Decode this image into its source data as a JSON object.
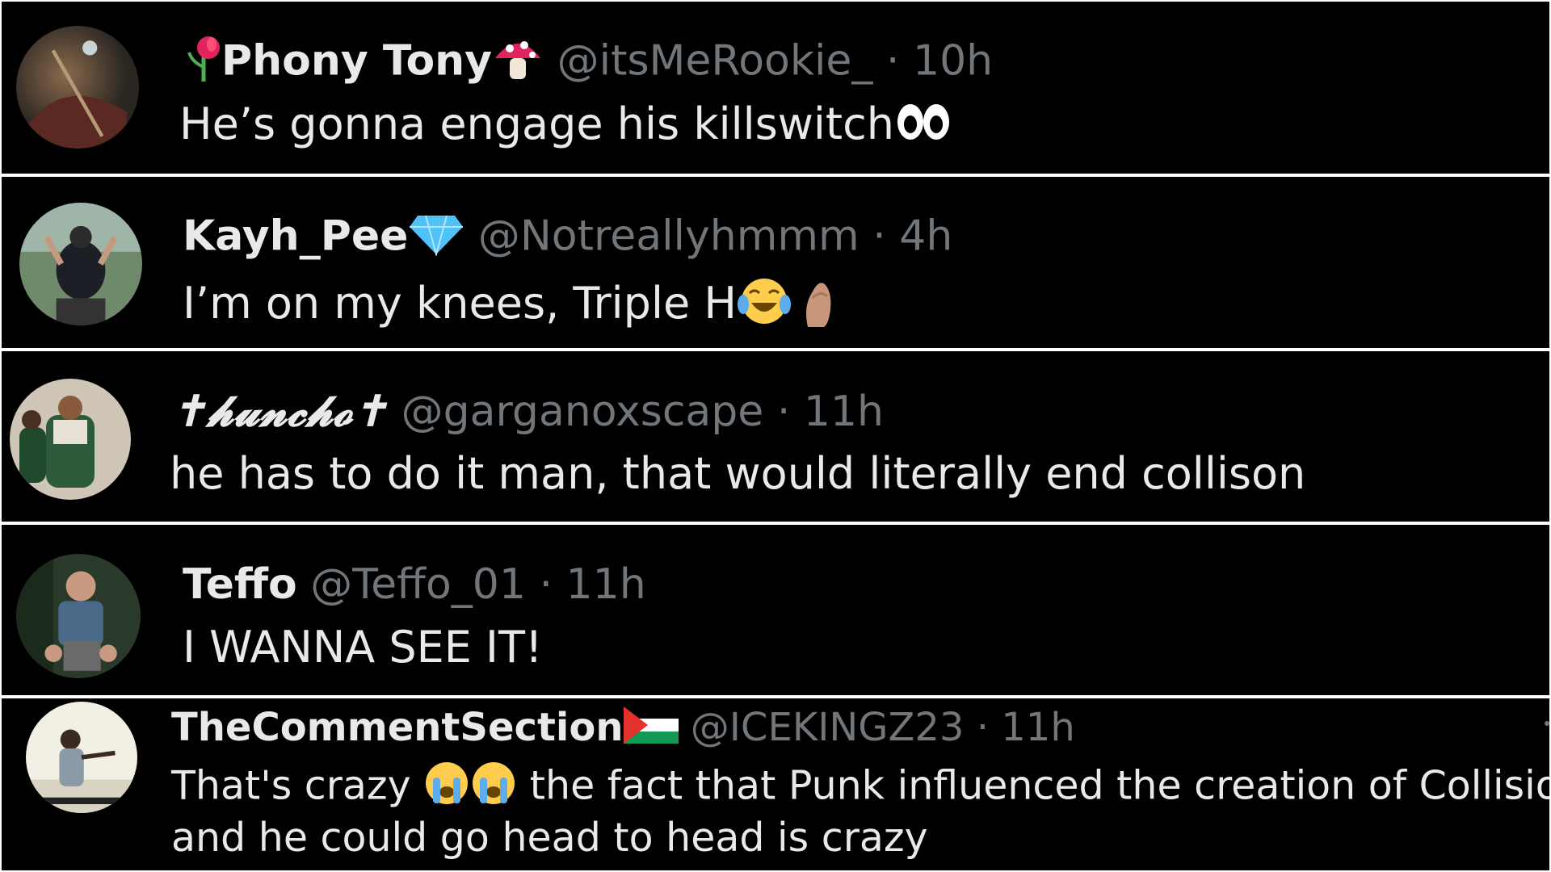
{
  "replies": [
    {
      "display_name": "Phony Tony",
      "handle": "@itsMeRookie_",
      "separator": "·",
      "time": "10h",
      "text": "He’s gonna engage his killswitch",
      "name_emojis": [
        "rose-wilted-icon",
        "mushroom-icon"
      ],
      "text_emojis": [
        "eyes-icon"
      ]
    },
    {
      "display_name": "Kayh_Pee",
      "handle": "@Notreallyhmmm",
      "separator": "·",
      "time": "4h",
      "text": "I’m on my knees, Triple H",
      "name_emojis": [
        "gem-icon"
      ],
      "text_emojis": [
        "laughing-tears-icon",
        "pinched-fingers-icon"
      ]
    },
    {
      "display_name": "✝𝓱𝓾𝓷𝓬𝓱𝓸✝",
      "handle": "@garganoxscape",
      "separator": "·",
      "time": "11h",
      "text": "he has to do it man, that would literally end collison",
      "name_emojis": [],
      "text_emojis": []
    },
    {
      "display_name": "Teffo",
      "handle": "@Teffo_01",
      "separator": "·",
      "time": "11h",
      "text": "I WANNA SEE IT!",
      "name_emojis": [],
      "text_emojis": []
    },
    {
      "display_name": "TheCommentSection",
      "handle": "@ICEKINGZ23",
      "separator": "·",
      "time": "11h",
      "text_before_emojis": "That's crazy",
      "text_after_emojis": "the fact that Punk influenced the creation of Collision",
      "text_line2": "and he could go head to head is crazy",
      "name_emojis": [
        "palestine-flag-icon"
      ],
      "text_emojis": [
        "crying-face-icon",
        "crying-face-icon"
      ]
    }
  ],
  "colors": {
    "background": "#000000",
    "name": "#e7e9ea",
    "handle": "#71767b",
    "border": "#ffffff"
  }
}
